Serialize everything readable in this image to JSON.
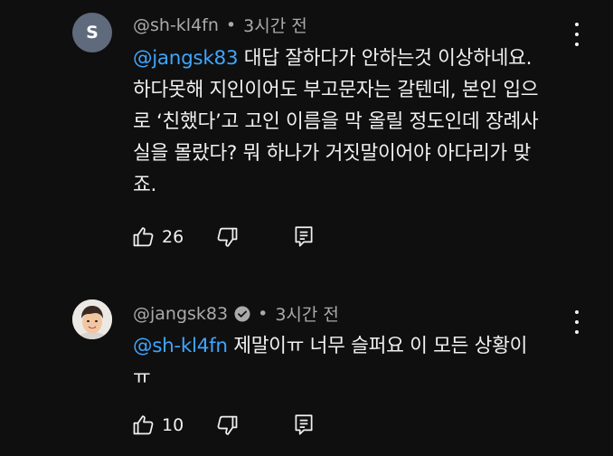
{
  "comments": [
    {
      "avatar_letter": "S",
      "author": "@sh-kl4fn",
      "separator": "•",
      "time": "3시간 전",
      "mention": "@jangsk83",
      "text_lines": [
        " 대답 잘하다가 안하는것 이상하네요.",
        "하다못해 지인이어도 부고문자는 갈텐데, 본인 입으",
        "로 ‘친했다’고 고인 이름을 막 올릴 정도인데 장례사",
        "실을 몰랐다? 뭐 하나가 거짓말이어야 아다리가 맞",
        "죠."
      ],
      "likes": "26",
      "like_icon": "thumb-up-icon",
      "dislike_icon": "thumb-down-icon",
      "reply_icon": "reply-icon",
      "menu_icon": "more-vert-icon"
    },
    {
      "author": "@jangsk83",
      "verified_icon": "verified-check-icon",
      "separator": "•",
      "time": "3시간 전",
      "mention": "@sh-kl4fn",
      "text_lines": [
        " 제말이ㅠ 너무 슬퍼요 이 모든 상황이",
        "ㅠ"
      ],
      "likes": "10",
      "like_icon": "thumb-up-icon",
      "dislike_icon": "thumb-down-icon",
      "reply_icon": "reply-icon",
      "menu_icon": "more-vert-icon"
    }
  ],
  "colors": {
    "background": "#0f0f0f",
    "text": "#f1f1f1",
    "secondary_text": "#aaaaaa",
    "mention": "#3ea6ff",
    "letter_avatar": "#5f6b7c"
  }
}
